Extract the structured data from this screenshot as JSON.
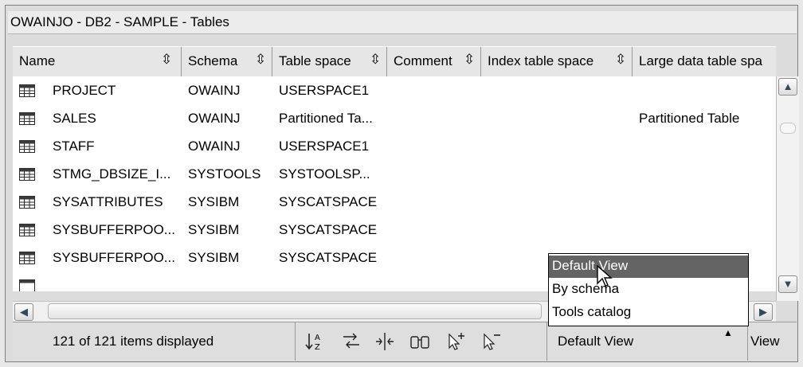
{
  "window": {
    "title": "OWAINJO - DB2 - SAMPLE - Tables"
  },
  "columns": [
    {
      "label": "Name",
      "sort_icon": "sort-arrows-icon"
    },
    {
      "label": "Schema",
      "sort_icon": "sort-arrows-icon"
    },
    {
      "label": "Table space",
      "sort_icon": "sort-arrows-icon"
    },
    {
      "label": "Comment",
      "sort_icon": "sort-arrows-icon"
    },
    {
      "label": "Index table space",
      "sort_icon": "sort-arrows-icon"
    },
    {
      "label": "Large data table spa",
      "sort_icon": ""
    }
  ],
  "sort_glyph": "⇳",
  "rows": [
    {
      "name": "PROJECT",
      "schema": "OWAINJ",
      "tablespace": "USERSPACE1",
      "comment": "",
      "index_ts": "",
      "large_ts": ""
    },
    {
      "name": "SALES",
      "schema": "OWAINJ",
      "tablespace": "Partitioned Ta...",
      "comment": "",
      "index_ts": "",
      "large_ts": "Partitioned Table"
    },
    {
      "name": "STAFF",
      "schema": "OWAINJ",
      "tablespace": "USERSPACE1",
      "comment": "",
      "index_ts": "",
      "large_ts": ""
    },
    {
      "name": "STMG_DBSIZE_I...",
      "schema": "SYSTOOLS",
      "tablespace": "SYSTOOLSP...",
      "comment": "",
      "index_ts": "",
      "large_ts": ""
    },
    {
      "name": "SYSATTRIBUTES",
      "schema": "SYSIBM",
      "tablespace": "SYSCATSPACE",
      "comment": "",
      "index_ts": "",
      "large_ts": ""
    },
    {
      "name": "SYSBUFFERPOO...",
      "schema": "SYSIBM",
      "tablespace": "SYSCATSPACE",
      "comment": "",
      "index_ts": "",
      "large_ts": ""
    },
    {
      "name": "SYSBUFFERPOO...",
      "schema": "SYSIBM",
      "tablespace": "SYSCATSPACE",
      "comment": "",
      "index_ts": "",
      "large_ts": ""
    }
  ],
  "status": {
    "text": "121 of 121 items displayed"
  },
  "toolbar": {
    "sort_glyph": "↓A Z",
    "filter_glyph": "⇄",
    "columns_glyph": "⇹",
    "find_glyph": "⌸",
    "select_all_glyph": "↖+",
    "deselect_glyph": "↖−"
  },
  "view_selector": {
    "current": "Default View",
    "button_label": "View",
    "options": [
      "Default View",
      "By schema",
      "Tools catalog"
    ],
    "highlighted_index": 0
  },
  "colors": {
    "highlight": "#646464",
    "background": "#dcdcdc",
    "table_bg": "#ffffff"
  }
}
